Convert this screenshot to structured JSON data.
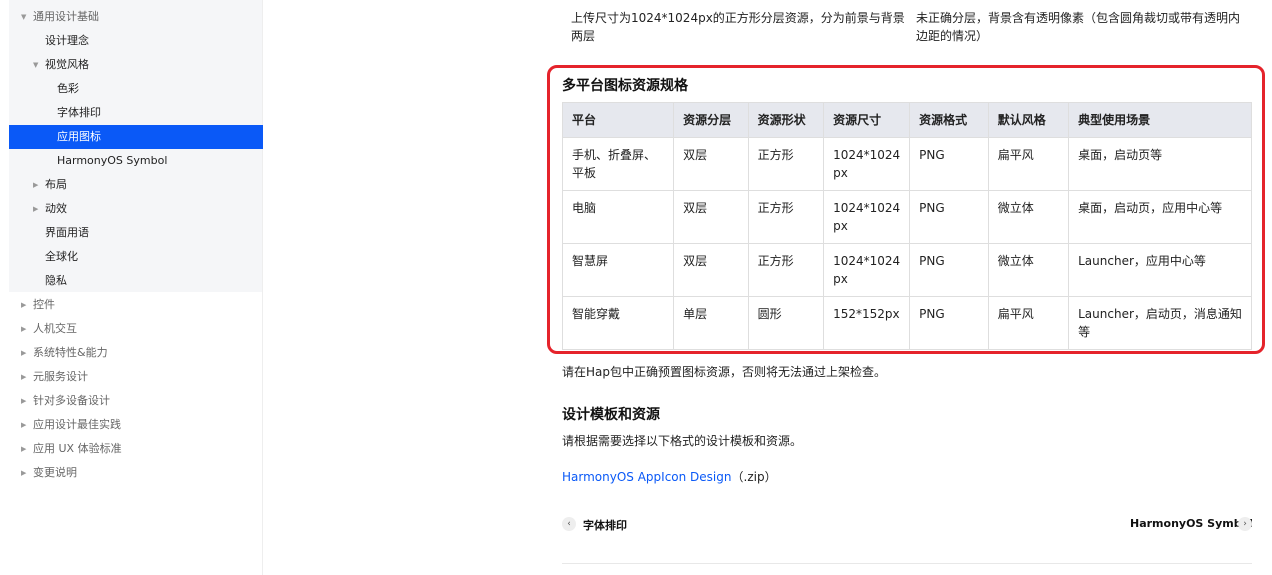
{
  "sidebar": {
    "items": [
      {
        "label": "通用设计基础",
        "arrow": "▼"
      },
      {
        "label": "设计理念"
      },
      {
        "label": "视觉风格",
        "arrow": "▼"
      },
      {
        "label": "色彩"
      },
      {
        "label": "字体排印"
      },
      {
        "label": "应用图标"
      },
      {
        "label": "HarmonyOS Symbol"
      },
      {
        "label": "布局",
        "arrow": "▶"
      },
      {
        "label": "动效",
        "arrow": "▶"
      },
      {
        "label": "界面用语"
      },
      {
        "label": "全球化"
      },
      {
        "label": "隐私"
      },
      {
        "label": "控件",
        "arrow": "▶"
      },
      {
        "label": "人机交互",
        "arrow": "▶"
      },
      {
        "label": "系统特性&能力",
        "arrow": "▶"
      },
      {
        "label": "元服务设计",
        "arrow": "▶"
      },
      {
        "label": "针对多设备设计",
        "arrow": "▶"
      },
      {
        "label": "应用设计最佳实践",
        "arrow": "▶"
      },
      {
        "label": "应用 UX 体验标准",
        "arrow": "▶"
      },
      {
        "label": "变更说明",
        "arrow": "▶"
      }
    ]
  },
  "top_row": {
    "left_line1": "上传尺寸为1024*1024px的正方形分层资源，分为前景与背景",
    "left_line2": "两层",
    "right_line1": "未正确分层，背景含有透明像素（包含圆角裁切或带有透明内",
    "right_line2": "边距的情况）"
  },
  "section1": {
    "title": "多平台图标资源规格",
    "headers": [
      "平台",
      "资源分层",
      "资源形状",
      "资源尺寸",
      "资源格式",
      "默认风格",
      "典型使用场景"
    ],
    "rows": [
      {
        "c1a": "手机、折叠屏、",
        "c1b": "平板",
        "c2": "双层",
        "c3": "正方形",
        "c4a": "1024*1024",
        "c4b": "px",
        "c5": "PNG",
        "c6": "扁平风",
        "c7a": "桌面，启动页等",
        "c7b": ""
      },
      {
        "c1a": "电脑",
        "c1b": "",
        "c2": "双层",
        "c3": "正方形",
        "c4a": "1024*1024",
        "c4b": "px",
        "c5": "PNG",
        "c6": "微立体",
        "c7a": "桌面，启动页，应用中心等",
        "c7b": ""
      },
      {
        "c1a": "智慧屏",
        "c1b": "",
        "c2": "双层",
        "c3": "正方形",
        "c4a": "1024*1024",
        "c4b": "px",
        "c5": "PNG",
        "c6": "微立体",
        "c7a": "Launcher，应用中心等",
        "c7b": ""
      },
      {
        "c1a": "智能穿戴",
        "c1b": "",
        "c2": "单层",
        "c3": "圆形",
        "c4a": "152*152px",
        "c4b": "",
        "c5": "PNG",
        "c6": "扁平风",
        "c7a": "Launcher，启动页，消息通知",
        "c7b": "等"
      }
    ],
    "note": "请在Hap包中正确预置图标资源，否则将无法通过上架检查。"
  },
  "section2": {
    "title": "设计模板和资源",
    "desc": "请根据需要选择以下格式的设计模板和资源。",
    "link_text": "HarmonyOS AppIcon Design",
    "link_suffix": "（.zip）"
  },
  "pager": {
    "prev_label": "字体排印",
    "next_label": "HarmonyOS Symbol",
    "prev_icon": "‹",
    "next_icon": "›"
  },
  "colors": {
    "accent": "#0a59f7",
    "highlight_border": "#e5232b",
    "table_header_bg": "#e6e8ee",
    "sidebar_bg": "#f5f6f8"
  }
}
